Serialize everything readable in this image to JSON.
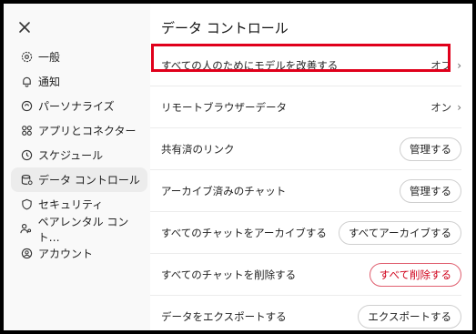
{
  "close_icon": "close-icon",
  "sidebar": {
    "items": [
      {
        "label": "一般",
        "icon": "gear-icon"
      },
      {
        "label": "通知",
        "icon": "bell-icon"
      },
      {
        "label": "パーソナライズ",
        "icon": "personalize-icon"
      },
      {
        "label": "アプリとコネクター",
        "icon": "apps-icon"
      },
      {
        "label": "スケジュール",
        "icon": "clock-icon"
      },
      {
        "label": "データ コントロール",
        "icon": "database-icon",
        "active": true
      },
      {
        "label": "セキュリティ",
        "icon": "shield-icon"
      },
      {
        "label": "ペアレンタル コント…",
        "icon": "parental-icon"
      },
      {
        "label": "アカウント",
        "icon": "account-icon"
      }
    ]
  },
  "main": {
    "title": "データ コントロール",
    "rows": [
      {
        "label": "すべての人のためにモデルを改善する",
        "value": "オフ"
      },
      {
        "label": "リモートブラウザーデータ",
        "value": "オン"
      },
      {
        "label": "共有済のリンク",
        "button": "管理する"
      },
      {
        "label": "アーカイブ済みのチャット",
        "button": "管理する"
      },
      {
        "label": "すべてのチャットをアーカイブする",
        "button": "すべてアーカイブする"
      },
      {
        "label": "すべてのチャットを削除する",
        "button": "すべて削除する"
      },
      {
        "label": "データをエクスポートする",
        "button": "エクスポートする"
      }
    ]
  },
  "colors": {
    "highlight": "#e0001b",
    "danger": "#d0021b"
  }
}
